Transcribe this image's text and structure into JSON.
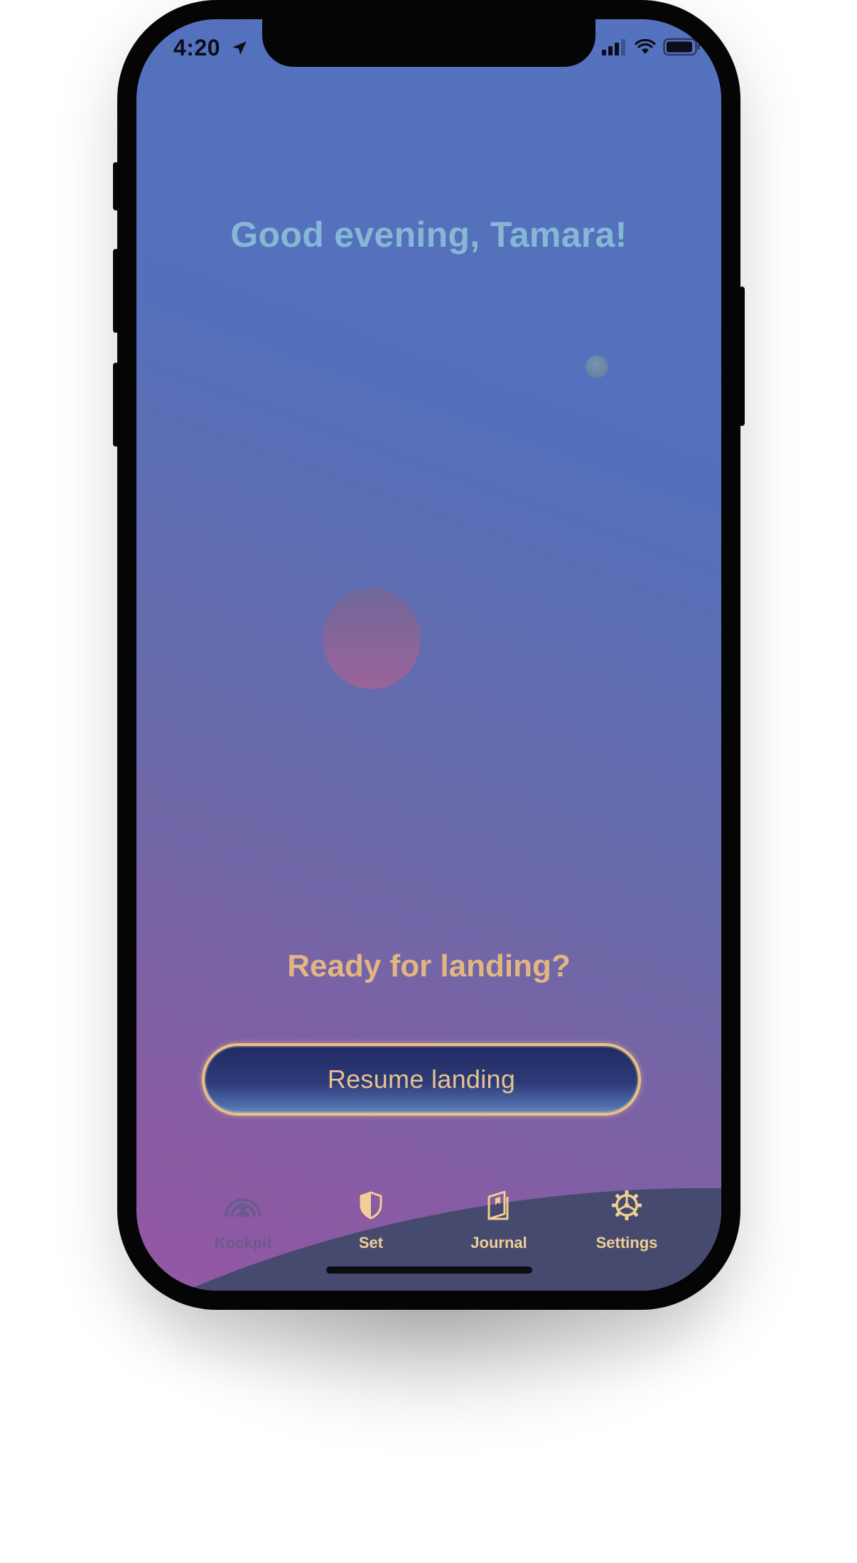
{
  "status_bar": {
    "time": "4:20"
  },
  "greeting": "Good evening, Tamara!",
  "prompt": "Ready for landing?",
  "resume_button": {
    "label": "Resume landing"
  },
  "tab_bar": {
    "items": [
      {
        "label": "Kockpit",
        "icon": "cockpit-icon",
        "active": false
      },
      {
        "label": "Set",
        "icon": "shield-icon",
        "active": true
      },
      {
        "label": "Journal",
        "icon": "journal-icon",
        "active": true
      },
      {
        "label": "Settings",
        "icon": "gear-icon",
        "active": true
      }
    ]
  },
  "colors": {
    "accent_gold": "#e2b681",
    "greeting_blue": "#86b8d6",
    "background_top": "#5472be",
    "background_bottom": "#9557a6",
    "button_fill": "#2e3b78"
  }
}
